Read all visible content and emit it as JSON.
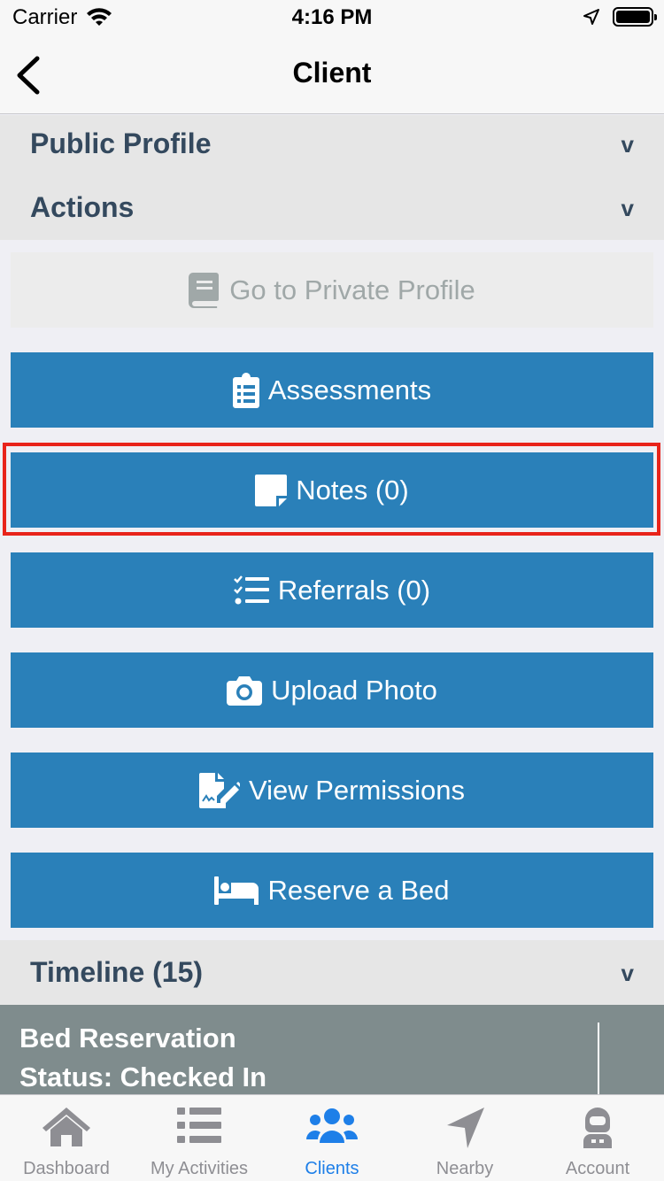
{
  "status_bar": {
    "carrier": "Carrier",
    "time": "4:16 PM"
  },
  "nav": {
    "title": "Client"
  },
  "sections": {
    "public_profile": {
      "label": "Public Profile",
      "chevron": "v"
    },
    "actions": {
      "label": "Actions",
      "chevron": "v"
    },
    "timeline": {
      "label": "Timeline (15)",
      "chevron": "v"
    }
  },
  "actions": {
    "private_profile": "Go to Private Profile",
    "assessments": "Assessments",
    "notes": "Notes (0)",
    "referrals": "Referrals (0)",
    "upload_photo": "Upload Photo",
    "view_permissions": "View Permissions",
    "reserve_bed": "Reserve a Bed"
  },
  "timeline_card": {
    "title": "Bed Reservation",
    "status": "Status: Checked In"
  },
  "tabs": [
    {
      "label": "Dashboard",
      "icon": "home-icon"
    },
    {
      "label": "My Activities",
      "icon": "list-icon"
    },
    {
      "label": "Clients",
      "icon": "users-icon"
    },
    {
      "label": "Nearby",
      "icon": "location-arrow-icon"
    },
    {
      "label": "Account",
      "icon": "astronaut-icon"
    }
  ],
  "colors": {
    "primary_button": "#2a80b9",
    "active_tab": "#1e7fe8",
    "section_text": "#34495e",
    "highlight": "#e8231a"
  }
}
